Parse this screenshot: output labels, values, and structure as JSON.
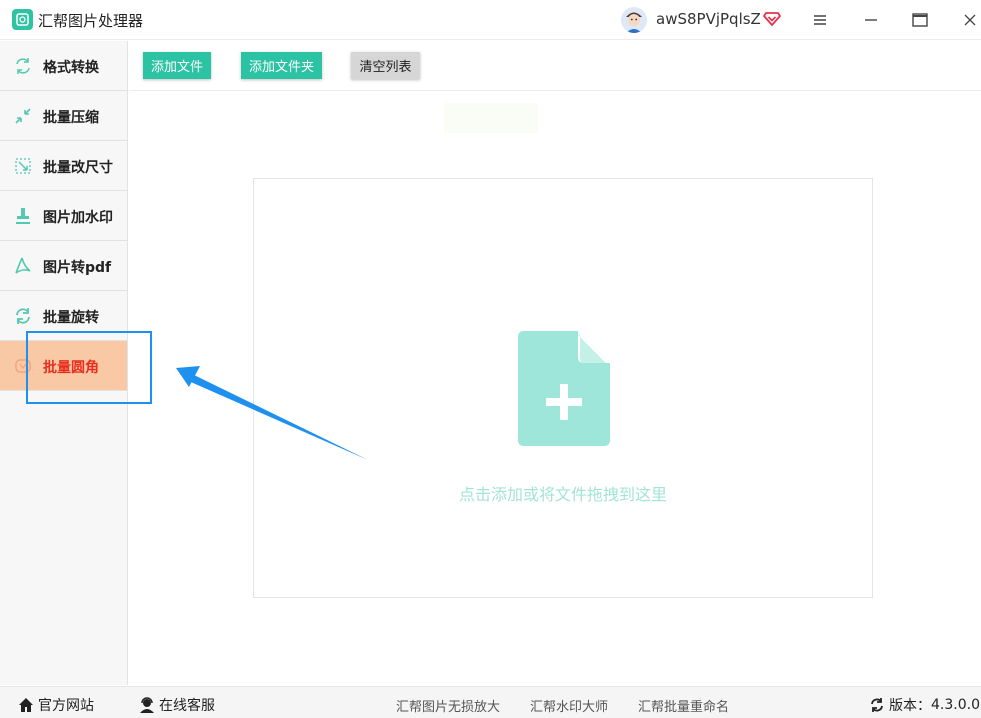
{
  "app": {
    "title": "汇帮图片处理器"
  },
  "user": {
    "name": "awS8PVjPqlsZ"
  },
  "toolbar": {
    "add_file": "添加文件",
    "add_folder": "添加文件夹",
    "clear_list": "清空列表"
  },
  "sidebar": {
    "items": [
      {
        "label": "格式转换",
        "icon": "format-convert-icon"
      },
      {
        "label": "批量压缩",
        "icon": "compress-icon"
      },
      {
        "label": "批量改尺寸",
        "icon": "resize-icon"
      },
      {
        "label": "图片加水印",
        "icon": "watermark-icon"
      },
      {
        "label": "图片转pdf",
        "icon": "pdf-icon"
      },
      {
        "label": "批量旋转",
        "icon": "rotate-icon"
      },
      {
        "label": "批量圆角",
        "icon": "round-corner-icon",
        "active": true
      }
    ]
  },
  "dropzone": {
    "hint": "点击添加或将文件拖拽到这里"
  },
  "footer": {
    "website": "官方网站",
    "support": "在线客服",
    "links": [
      "汇帮图片无损放大",
      "汇帮水印大师",
      "汇帮批量重命名"
    ],
    "version_label": "版本：",
    "version": "4.3.0.0"
  },
  "colors": {
    "accent": "#2cc3a4",
    "active_bg": "#f9c9a6",
    "active_text": "#e8301f",
    "annotation": "#1e90ef",
    "drop_icon": "#9ee6d9"
  }
}
